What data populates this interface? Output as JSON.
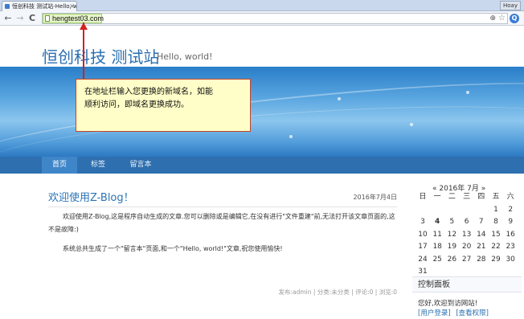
{
  "browser": {
    "tab_title": "恒创科技 测试站-Hello, w",
    "tab_close": "×",
    "window_button": "Hoay",
    "url": "hengtest03.com",
    "zoom_glyph": "⊕",
    "star_glyph": "☆",
    "ext_glyph": "Q",
    "back_glyph": "←",
    "forward_glyph": "→",
    "reload_glyph": "C"
  },
  "site": {
    "title": "恒创科技 测试站",
    "subtitle": "Hello, world!"
  },
  "nav": {
    "items": [
      {
        "label": "首页"
      },
      {
        "label": "标签"
      },
      {
        "label": "留言本"
      }
    ]
  },
  "post": {
    "title": "欢迎使用Z-Blog！",
    "date": "2016年7月4日",
    "para1": "欢迎使用Z-Blog,这是程序自动生成的文章.您可以删除或是编辑它,在没有进行\"文件重建\"前,无法打开该文章页面的,这不是故障:)",
    "para2": "系统总共生成了一个\"留言本\"页面,和一个\"Hello, world!\"文章,祝您使用愉快!",
    "meta": "发布:admin | 分类:未分类 | 评论:0 | 浏览:0"
  },
  "calendar": {
    "title": "« 2016年 7月 »",
    "weekdays": [
      "日",
      "一",
      "二",
      "三",
      "四",
      "五",
      "六"
    ],
    "rows": [
      [
        "",
        "",
        "",
        "",
        "",
        "1",
        "2"
      ],
      [
        "3",
        "4",
        "5",
        "6",
        "7",
        "8",
        "9"
      ],
      [
        "10",
        "11",
        "12",
        "13",
        "14",
        "15",
        "16"
      ],
      [
        "17",
        "18",
        "19",
        "20",
        "21",
        "22",
        "23"
      ],
      [
        "24",
        "25",
        "26",
        "27",
        "28",
        "29",
        "30"
      ],
      [
        "31",
        "",
        "",
        "",
        "",
        "",
        ""
      ]
    ],
    "highlight": "4"
  },
  "panel": {
    "title": "控制面板",
    "welcome": "您好,欢迎到访网站!",
    "login_link": "[用户登录]",
    "rights_link": "[查看权限]"
  },
  "annotation": {
    "line1": "在地址栏输入您更换的新域名，如能",
    "line2": "顺利访问，即域名更换成功。",
    "border_color": "#c4452a",
    "arrow_color": "#d32020"
  }
}
